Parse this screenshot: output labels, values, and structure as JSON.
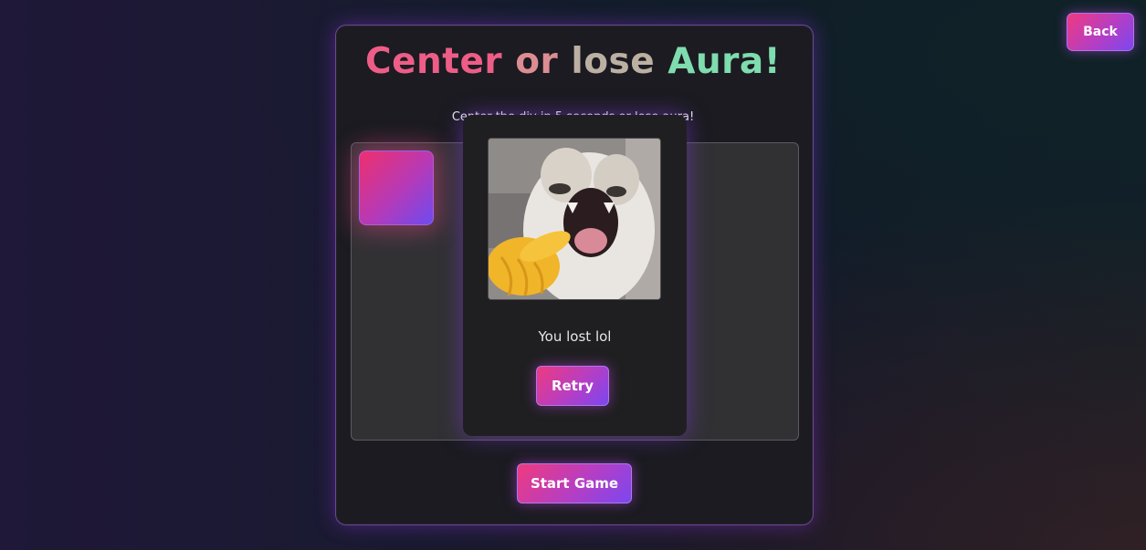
{
  "header": {
    "back_label": "Back"
  },
  "game": {
    "title_words": [
      "Center",
      "or",
      "lose",
      "Aura!"
    ],
    "subtitle": "Center the div in 5 seconds or lose aura!",
    "start_label": "Start Game"
  },
  "modal": {
    "image_icon": "screaming-cat-pointing-meme",
    "message": "You lost lol",
    "retry_label": "Retry"
  },
  "colors": {
    "accent_pink": "#ef3a7e",
    "accent_violet": "#7b47f0",
    "title_pink": "#ee5d87",
    "title_mint": "#7fdcae"
  }
}
